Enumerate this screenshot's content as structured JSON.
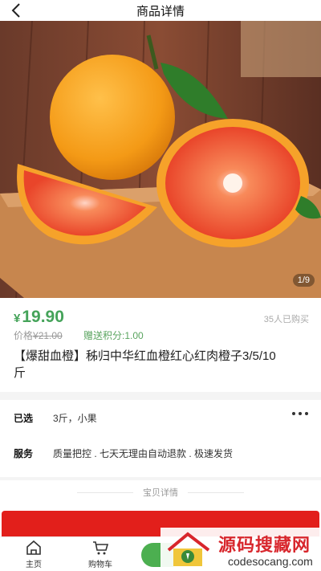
{
  "header": {
    "title": "商品详情"
  },
  "hero": {
    "counter": "1/9"
  },
  "product": {
    "currency": "¥",
    "price": "19.90",
    "sold": "35人已购买",
    "orig_label": "价格",
    "orig_price": "¥21.00",
    "points": "赠送积分:1.00",
    "title": "【爆甜血橙】秭归中华红血橙红心红肉橙子3/5/10斤"
  },
  "options": {
    "selected_label": "已选",
    "selected_value": "3斤，小果",
    "service_label": "服务",
    "service_value": "质量把控 . 七天无理由自动退款 . 极速发货"
  },
  "detail_divider": "宝贝详情",
  "tabbar": {
    "home": "主页",
    "cart": "购物车"
  },
  "watermark": {
    "title": "源码搜藏网",
    "url": "codesocang.com"
  },
  "colors": {
    "accent": "#45a35a",
    "banner": "#e21f1b"
  }
}
